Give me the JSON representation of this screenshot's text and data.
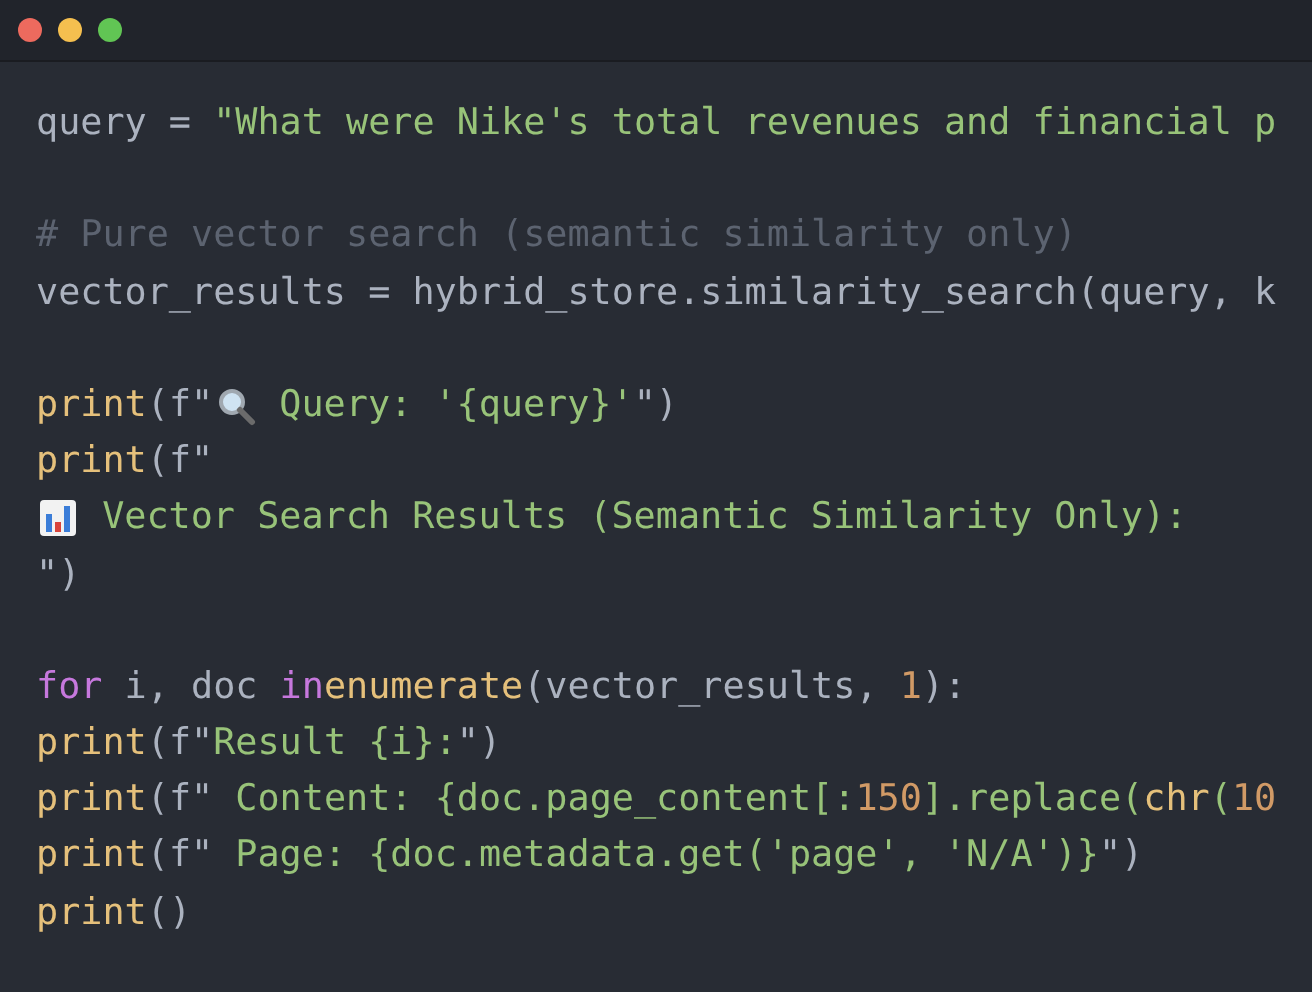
{
  "window_controls": [
    {
      "color": "#ed6a5e"
    },
    {
      "color": "#f5bf4f"
    },
    {
      "color": "#61c554"
    }
  ],
  "code_lines": [
    {
      "kind": "code",
      "tokens": [
        {
          "kind": "plain",
          "text": "query = "
        },
        {
          "kind": "string",
          "text": "\"What were Nike's total revenues and financial p"
        }
      ]
    },
    {
      "kind": "blank"
    },
    {
      "kind": "code",
      "tokens": [
        {
          "kind": "comment",
          "text": "# Pure vector search (semantic similarity only)"
        }
      ]
    },
    {
      "kind": "code",
      "tokens": [
        {
          "kind": "plain",
          "text": "vector_results = hybrid_store.similarity_search(query, k"
        }
      ]
    },
    {
      "kind": "blank"
    },
    {
      "kind": "code",
      "tokens": [
        {
          "kind": "function",
          "text": "print"
        },
        {
          "kind": "plain",
          "text": "(f\""
        },
        {
          "kind": "magnifier"
        },
        {
          "kind": "string",
          "text": " Query: '{query}'"
        },
        {
          "kind": "plain",
          "text": "\")"
        }
      ]
    },
    {
      "kind": "code",
      "tokens": [
        {
          "kind": "function",
          "text": "print"
        },
        {
          "kind": "plain",
          "text": "(f\""
        }
      ]
    },
    {
      "kind": "code",
      "tokens": [
        {
          "kind": "barchart"
        },
        {
          "kind": "string",
          "text": " Vector Search Results (Semantic Similarity Only):"
        }
      ]
    },
    {
      "kind": "code",
      "tokens": [
        {
          "kind": "plain",
          "text": "\")"
        }
      ]
    },
    {
      "kind": "blank"
    },
    {
      "kind": "code",
      "tokens": [
        {
          "kind": "keyword",
          "text": "for"
        },
        {
          "kind": "plain",
          "text": " i, doc "
        },
        {
          "kind": "keyword",
          "text": "in"
        },
        {
          "kind": "function",
          "text": "enumerate"
        },
        {
          "kind": "plain",
          "text": "(vector_results, "
        },
        {
          "kind": "number",
          "text": "1"
        },
        {
          "kind": "plain",
          "text": "):"
        }
      ]
    },
    {
      "kind": "code",
      "tokens": [
        {
          "kind": "function",
          "text": "print"
        },
        {
          "kind": "plain",
          "text": "(f\""
        },
        {
          "kind": "string",
          "text": "Result {i}:"
        },
        {
          "kind": "plain",
          "text": "\")"
        }
      ]
    },
    {
      "kind": "code",
      "tokens": [
        {
          "kind": "function",
          "text": "print"
        },
        {
          "kind": "plain",
          "text": "(f\""
        },
        {
          "kind": "string",
          "text": " Content: {doc.page_content[:"
        },
        {
          "kind": "number",
          "text": "150"
        },
        {
          "kind": "string",
          "text": "].replace("
        },
        {
          "kind": "function",
          "text": "chr"
        },
        {
          "kind": "string",
          "text": "("
        },
        {
          "kind": "number",
          "text": "10"
        }
      ]
    },
    {
      "kind": "code",
      "tokens": [
        {
          "kind": "function",
          "text": "print"
        },
        {
          "kind": "plain",
          "text": "(f\""
        },
        {
          "kind": "string",
          "text": " Page: {doc.metadata.get('page', 'N/A')}"
        },
        {
          "kind": "plain",
          "text": "\")"
        }
      ]
    },
    {
      "kind": "code",
      "tokens": [
        {
          "kind": "function",
          "text": "print"
        },
        {
          "kind": "plain",
          "text": "()"
        }
      ]
    }
  ]
}
